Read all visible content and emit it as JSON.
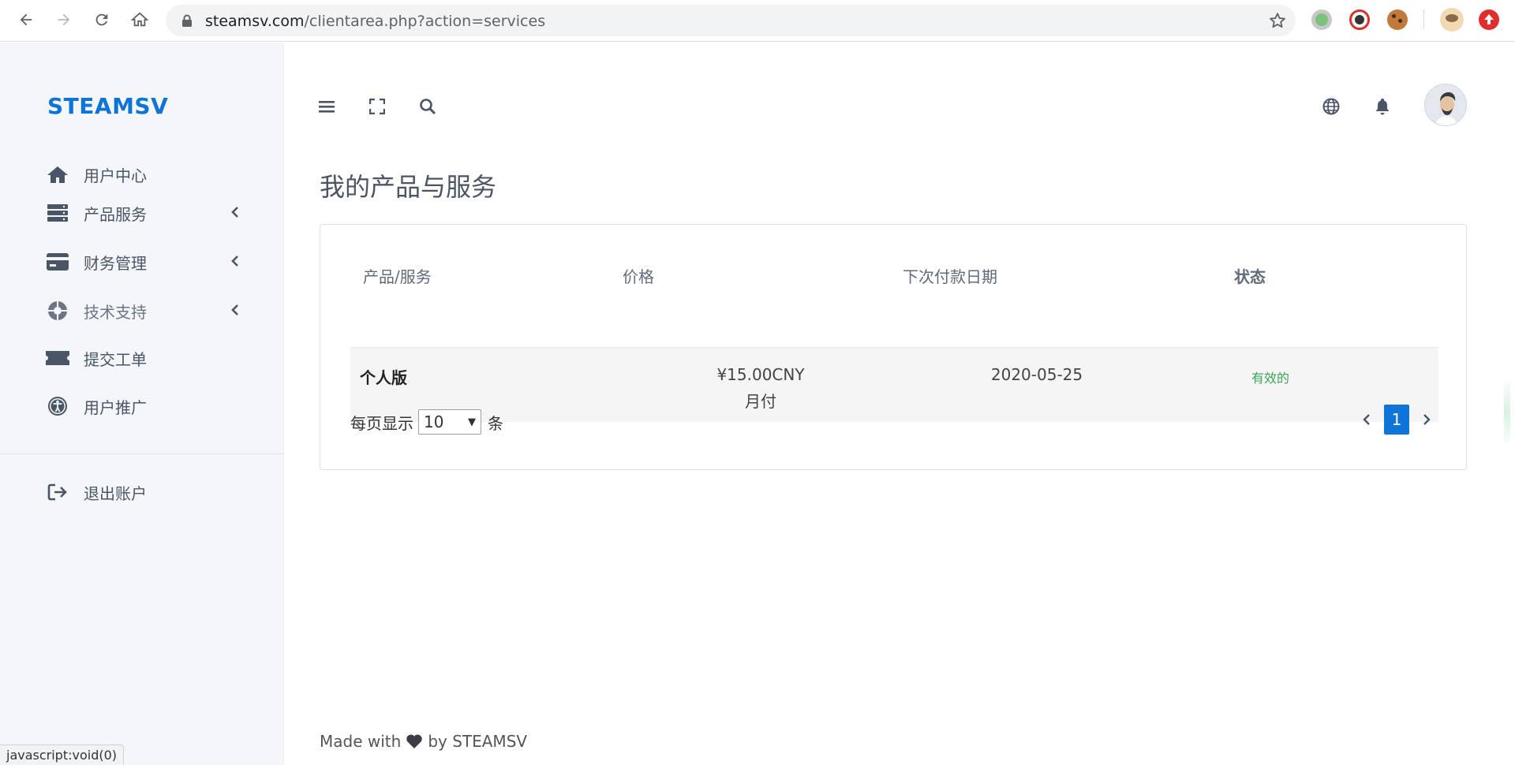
{
  "browser": {
    "url_host": "steamsv.com",
    "url_path": "/clientarea.php?action=services",
    "status_text": "javascript:void(0)"
  },
  "sidebar": {
    "brand": "STEAMSV",
    "items": [
      {
        "label": "用户中心",
        "icon": "home-icon",
        "has_chevron": false
      },
      {
        "label": "产品服务",
        "icon": "server-icon",
        "has_chevron": true
      },
      {
        "label": "财务管理",
        "icon": "credit-card-icon",
        "has_chevron": true
      },
      {
        "label": "技术支持",
        "icon": "life-ring-icon",
        "has_chevron": true
      },
      {
        "label": "提交工单",
        "icon": "ticket-icon",
        "has_chevron": false
      },
      {
        "label": "用户推广",
        "icon": "universal-access-icon",
        "has_chevron": false
      }
    ],
    "logout": {
      "label": "退出账户",
      "icon": "sign-out-icon"
    }
  },
  "topbar": {
    "icons": [
      "menu-icon",
      "fullscreen-icon",
      "search-icon",
      "globe-icon",
      "bell-icon"
    ]
  },
  "main": {
    "title": "我的产品与服务",
    "table": {
      "headers": [
        "产品/服务",
        "价格",
        "下次付款日期",
        "状态"
      ],
      "rows": [
        {
          "name": "个人版",
          "price": "¥15.00CNY",
          "cycle": "月付",
          "next_due": "2020-05-25",
          "status": "有效的"
        }
      ]
    },
    "pagination": {
      "per_page_prefix": "每页显示",
      "per_page_value": "10",
      "per_page_suffix": "条",
      "current_page": "1"
    }
  },
  "footer": {
    "prefix": "Made with",
    "suffix": "by STEAMSV"
  },
  "colors": {
    "brand": "#0f74d8",
    "status_active": "#3aa652",
    "sidebar_bg": "#f4f6f9"
  }
}
